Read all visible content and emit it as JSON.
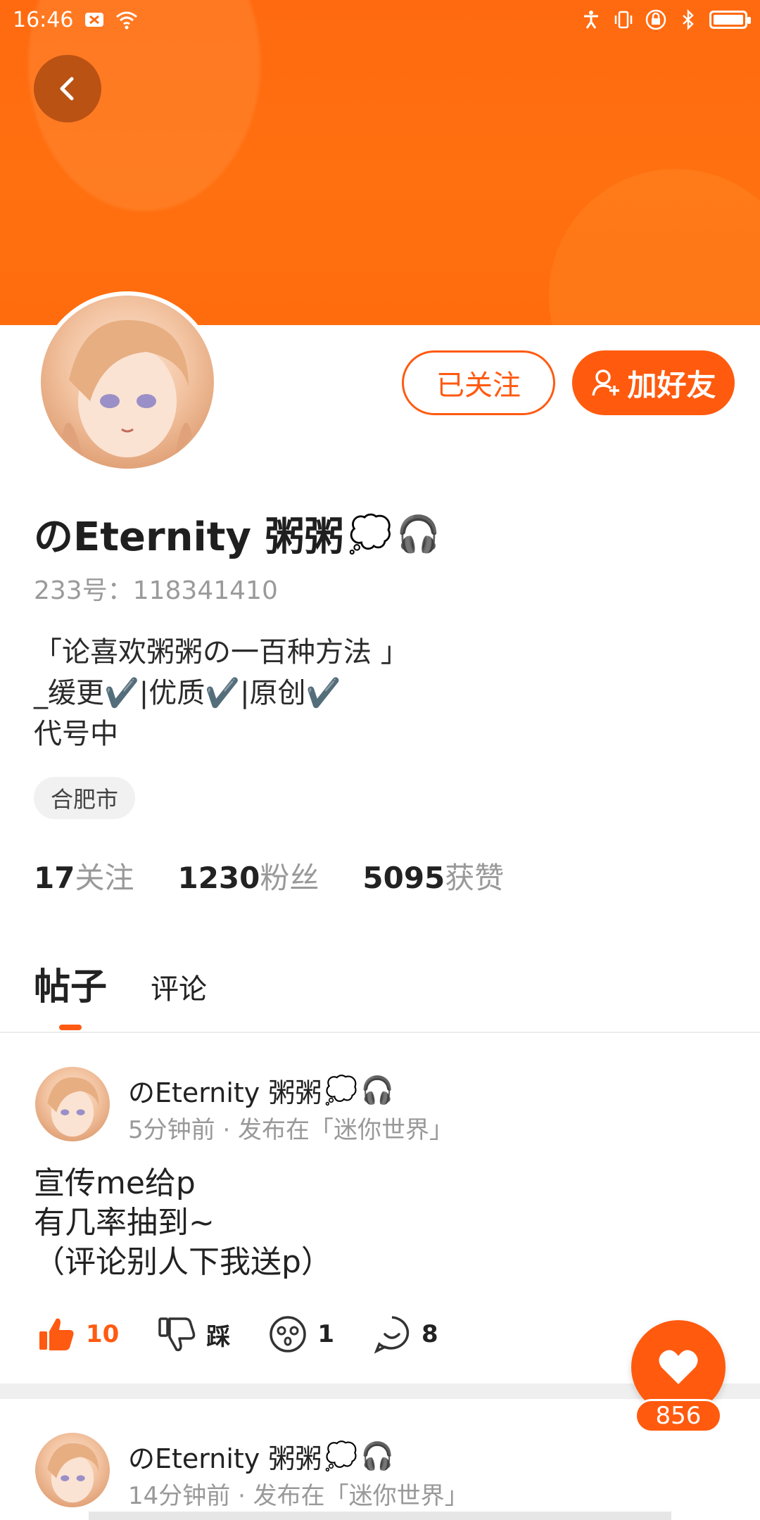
{
  "status_bar": {
    "time": "16:46"
  },
  "profile": {
    "name": "のEternity 粥粥",
    "name_emoji_1": "💭",
    "name_emoji_2": "🎧",
    "id_text": "233号：118341410",
    "bio_lines": [
      "「论喜欢粥粥の一百种方法 」",
      "_缓更✔️|优质✔️|原创✔️",
      "代号中"
    ],
    "location": "合肥市",
    "follow_button": "已关注",
    "add_friend_button": "加好友",
    "stats": [
      {
        "num": "17",
        "label": "关注"
      },
      {
        "num": "1230",
        "label": "粉丝"
      },
      {
        "num": "5095",
        "label": "获赞"
      }
    ]
  },
  "tabs": {
    "posts": "帖子",
    "comments": "评论"
  },
  "posts": [
    {
      "author": "のEternity 粥粥",
      "emoji_1": "💭",
      "emoji_2": "🎧",
      "meta": "5分钟前 · 发布在「迷你世界」",
      "content_lines": [
        "宣传me给p",
        "有几率抽到~",
        "（评论别人下我送p）"
      ],
      "like_count": "10",
      "dislike_label": "踩",
      "wow_count": "1",
      "comment_count": "8"
    },
    {
      "author": "のEternity 粥粥",
      "emoji_1": "💭",
      "emoji_2": "🎧",
      "meta": "14分钟前 · 发布在「迷你世界」"
    }
  ],
  "fab": {
    "count": "856"
  },
  "colors": {
    "accent": "#ff5a12",
    "banner": "#ff6a10"
  }
}
